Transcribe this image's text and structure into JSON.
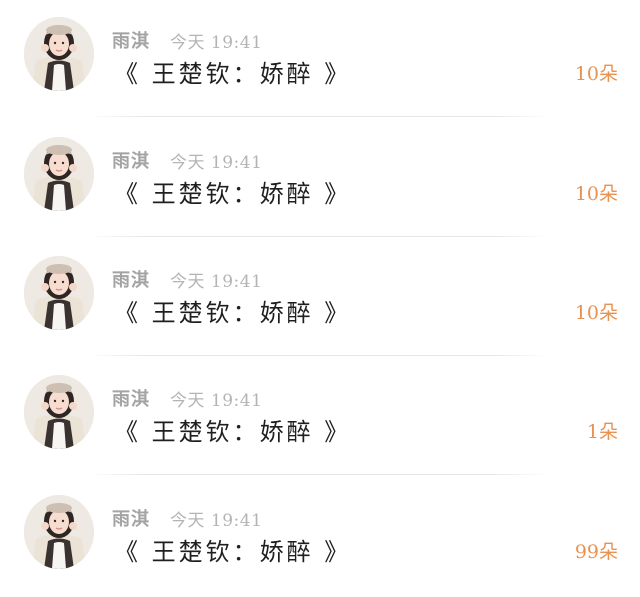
{
  "messages": [
    {
      "user": "雨淇",
      "time": "今天 19:41",
      "text": "《 王楚钦：娇醉 》",
      "count": "10朵"
    },
    {
      "user": "雨淇",
      "time": "今天 19:41",
      "text": "《 王楚钦：娇醉 》",
      "count": "10朵"
    },
    {
      "user": "雨淇",
      "time": "今天 19:41",
      "text": "《 王楚钦：娇醉 》",
      "count": "10朵"
    },
    {
      "user": "雨淇",
      "time": "今天 19:41",
      "text": "《 王楚钦：娇醉 》",
      "count": "1朵"
    },
    {
      "user": "雨淇",
      "time": "今天 19:41",
      "text": "《 王楚钦：娇醉 》",
      "count": "99朵"
    }
  ],
  "colors": {
    "count_accent": "#e89252",
    "name_gray": "#a3a3a3",
    "time_gray": "#b4b4b4",
    "text_dark": "#1f1f1f"
  },
  "icons": {
    "avatar": "avatar-photo"
  }
}
